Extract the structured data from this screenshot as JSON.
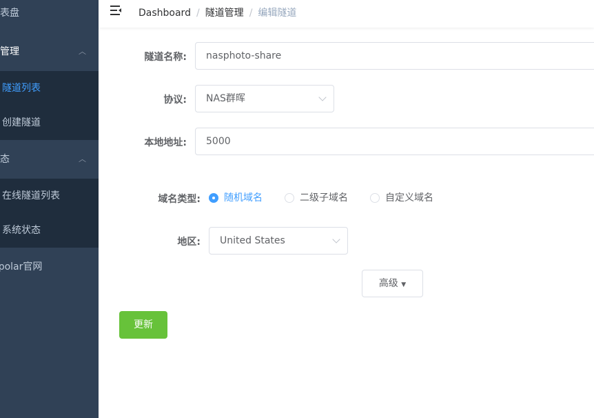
{
  "sidebar": {
    "items": [
      {
        "label": "仪表盘",
        "type": "item"
      },
      {
        "label": "隧道管理",
        "type": "group"
      },
      {
        "label": "隧道列表",
        "type": "sub",
        "active": true
      },
      {
        "label": "创建隧道",
        "type": "sub"
      },
      {
        "label": "状态",
        "type": "group"
      },
      {
        "label": "在线隧道列表",
        "type": "sub"
      },
      {
        "label": "系统状态",
        "type": "sub"
      },
      {
        "label": "cpolar官网",
        "type": "item"
      }
    ]
  },
  "header": {
    "breadcrumb": [
      "Dashboard",
      "隧道管理",
      "编辑隧道"
    ]
  },
  "form": {
    "name_label": "隧道名称:",
    "name_value": "nasphoto-share",
    "protocol_label": "协议:",
    "protocol_value": "NAS群晖",
    "local_label": "本地地址:",
    "local_value": "5000",
    "domain_type_label": "域名类型:",
    "domain_types": [
      "随机域名",
      "二级子域名",
      "自定义域名"
    ],
    "domain_type_selected": "随机域名",
    "region_label": "地区:",
    "region_value": "United States",
    "advanced_label": "高级",
    "update_label": "更新"
  },
  "colors": {
    "sidebar": "#304156",
    "submenu": "#1f2d3d",
    "active": "#409eff",
    "success": "#67c23a"
  }
}
